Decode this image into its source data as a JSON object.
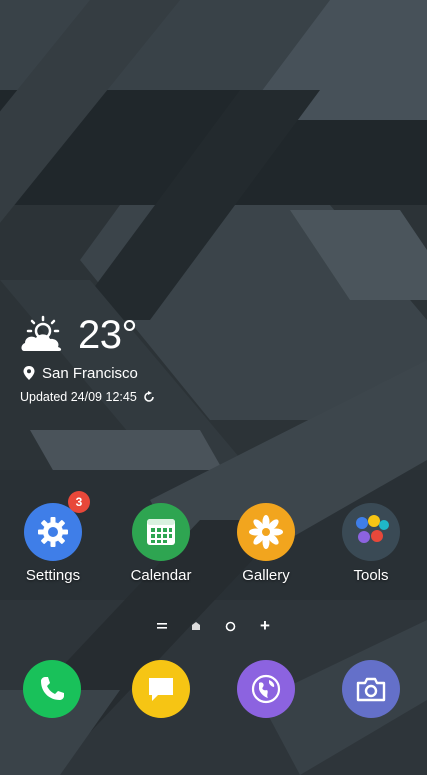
{
  "weather": {
    "temperature": "23°",
    "location": "San Francisco",
    "updated": "Updated 24/09 12:45"
  },
  "home_apps": [
    {
      "label": "Settings",
      "badge": "3",
      "color": "#3f7ee8"
    },
    {
      "label": "Calendar",
      "color": "#2ea551"
    },
    {
      "label": "Gallery",
      "color": "#f2a51e"
    },
    {
      "label": "Tools",
      "color": "#3a4a55"
    }
  ],
  "dock_apps": [
    {
      "name": "phone",
      "color": "#19c15a"
    },
    {
      "name": "messages",
      "color": "#f6c514"
    },
    {
      "name": "internet",
      "color": "#8c63e0"
    },
    {
      "name": "camera",
      "color": "#6470c9"
    }
  ],
  "pager": {
    "home": "home",
    "page": "page",
    "add": "+"
  }
}
